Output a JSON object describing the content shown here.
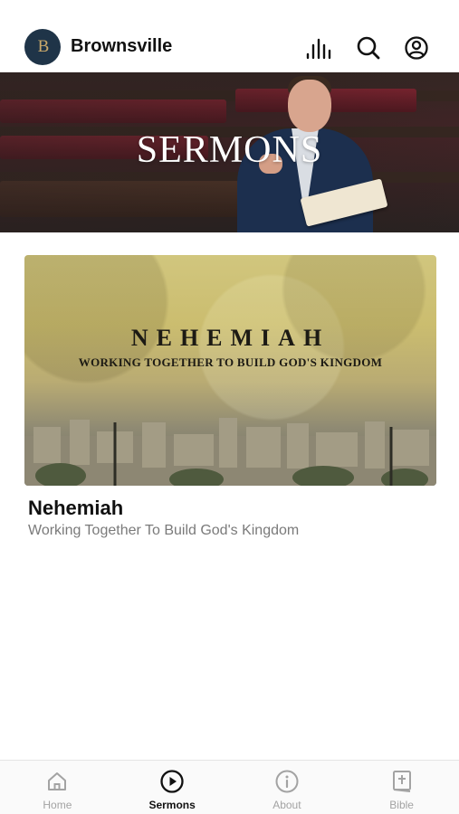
{
  "header": {
    "logo_text": "B",
    "app_title": "Brownsville",
    "icons": [
      "audio-bars-icon",
      "search-icon",
      "account-icon"
    ]
  },
  "hero": {
    "title": "SERMONS"
  },
  "series": {
    "image_title": "NEHEMIAH",
    "image_subtitle": "WORKING TOGETHER TO BUILD GOD'S KINGDOM",
    "title": "Nehemiah",
    "subtitle": "Working Together To Build God's Kingdom"
  },
  "tabs": [
    {
      "label": "Home",
      "icon": "home-icon",
      "active": false
    },
    {
      "label": "Sermons",
      "icon": "play-circle-icon",
      "active": true
    },
    {
      "label": "About",
      "icon": "info-circle-icon",
      "active": false
    },
    {
      "label": "Bible",
      "icon": "bible-icon",
      "active": false
    }
  ],
  "colors": {
    "logo_bg": "#1f3448",
    "logo_text": "#c9a86a",
    "active_tab": "#111111",
    "inactive_tab": "#a3a3a3"
  }
}
